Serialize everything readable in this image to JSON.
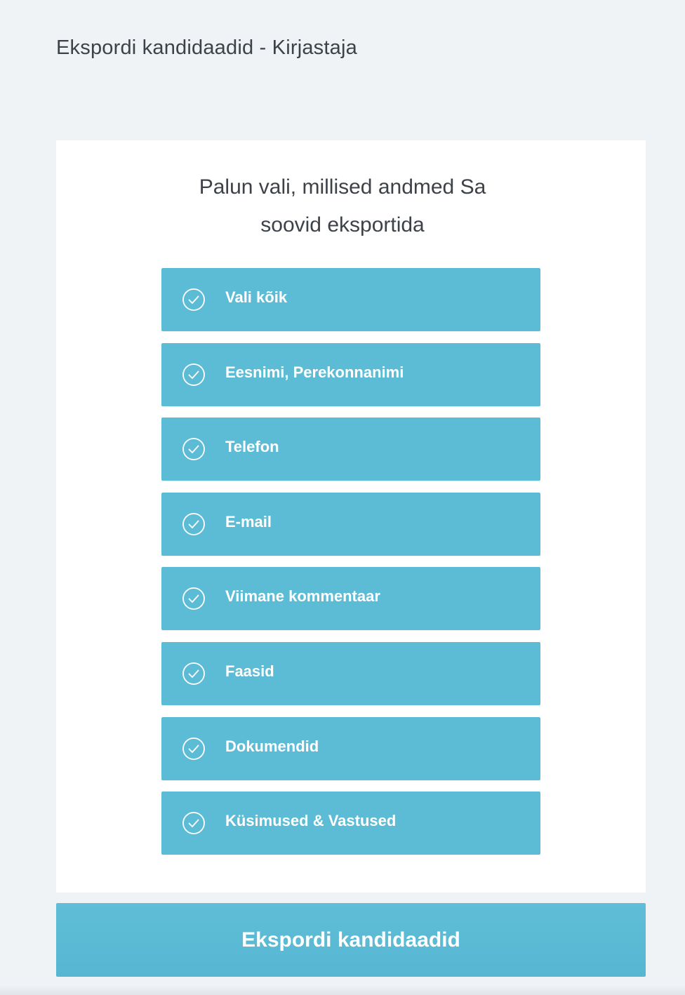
{
  "header": {
    "title": "Ekspordi kandidaadid - Kirjastaja"
  },
  "panel": {
    "prompt_line1": "Palun vali, millised andmed Sa",
    "prompt_line2": "soovid eksportida",
    "options": [
      {
        "label": "Vali kõik",
        "icon": "check-circle-icon",
        "checked": true
      },
      {
        "label": "Eesnimi, Perekonnanimi",
        "icon": "check-circle-icon",
        "checked": true
      },
      {
        "label": "Telefon",
        "icon": "check-circle-icon",
        "checked": true
      },
      {
        "label": "E-mail",
        "icon": "check-circle-icon",
        "checked": true
      },
      {
        "label": "Viimane kommentaar",
        "icon": "check-circle-icon",
        "checked": true
      },
      {
        "label": "Faasid",
        "icon": "check-circle-icon",
        "checked": true
      },
      {
        "label": "Dokumendid",
        "icon": "check-circle-icon",
        "checked": true
      },
      {
        "label": "Küsimused & Vastused",
        "icon": "check-circle-icon",
        "checked": true
      }
    ]
  },
  "actions": {
    "export_label": "Ekspordi kandidaadid"
  },
  "colors": {
    "background": "#eff3f6",
    "panel": "#ffffff",
    "accent": "#5cbcd6",
    "text": "#3d4249"
  }
}
